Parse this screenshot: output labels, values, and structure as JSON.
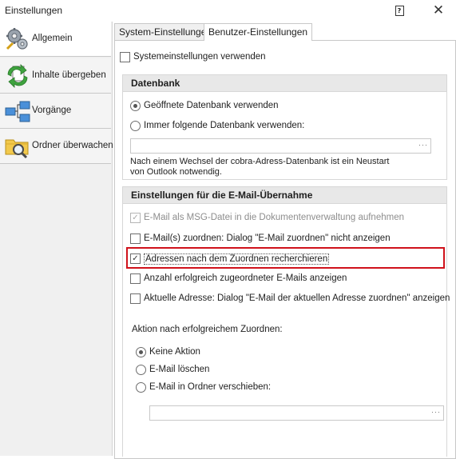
{
  "window": {
    "title": "Einstellungen",
    "help_label": "?",
    "close_label": "✕"
  },
  "sidebar": {
    "items": [
      {
        "label": "Allgemein",
        "icon": "gears-icon"
      },
      {
        "label": "Inhalte übergeben",
        "icon": "transfer-arrows-icon"
      },
      {
        "label": "Vorgänge",
        "icon": "process-flow-icon"
      },
      {
        "label": "Ordner überwachen",
        "icon": "folder-search-icon"
      }
    ]
  },
  "tabs": [
    {
      "label": "System-Einstellungen"
    },
    {
      "label": "Benutzer-Einstellungen"
    }
  ],
  "panel": {
    "use_system_settings": {
      "label": "Systemeinstellungen verwenden",
      "checked": false
    },
    "database": {
      "title": "Datenbank",
      "option_open": "Geöffnete Datenbank verwenden",
      "option_always": "Immer folgende Datenbank verwenden:",
      "field_button": "···",
      "note_line1": "Nach einem Wechsel der cobra-Adress-Datenbank ist ein Neustart",
      "note_line2": "von Outlook notwendig."
    },
    "email": {
      "title": "Einstellungen für die E-Mail-Übernahme",
      "opt_msg": "E-Mail als MSG-Datei in die Dokumentenverwaltung aufnehmen",
      "opt_assign_dialog": "E-Mail(s) zuordnen: Dialog \"E-Mail zuordnen\" nicht anzeigen",
      "opt_research": "Adressen nach dem Zuordnen recherchieren",
      "opt_count": "Anzahl erfolgreich zugeordneter E-Mails anzeigen",
      "opt_current_address": "Aktuelle Adresse: Dialog \"E-Mail der aktuellen Adresse zuordnen\" anzeigen",
      "action_label": "Aktion nach erfolgreichem Zuordnen:",
      "action_none": "Keine Aktion",
      "action_delete": "E-Mail löschen",
      "action_move": "E-Mail in Ordner verschieben:",
      "field_button": "···"
    }
  },
  "colors": {
    "highlight": "#d0121b"
  }
}
